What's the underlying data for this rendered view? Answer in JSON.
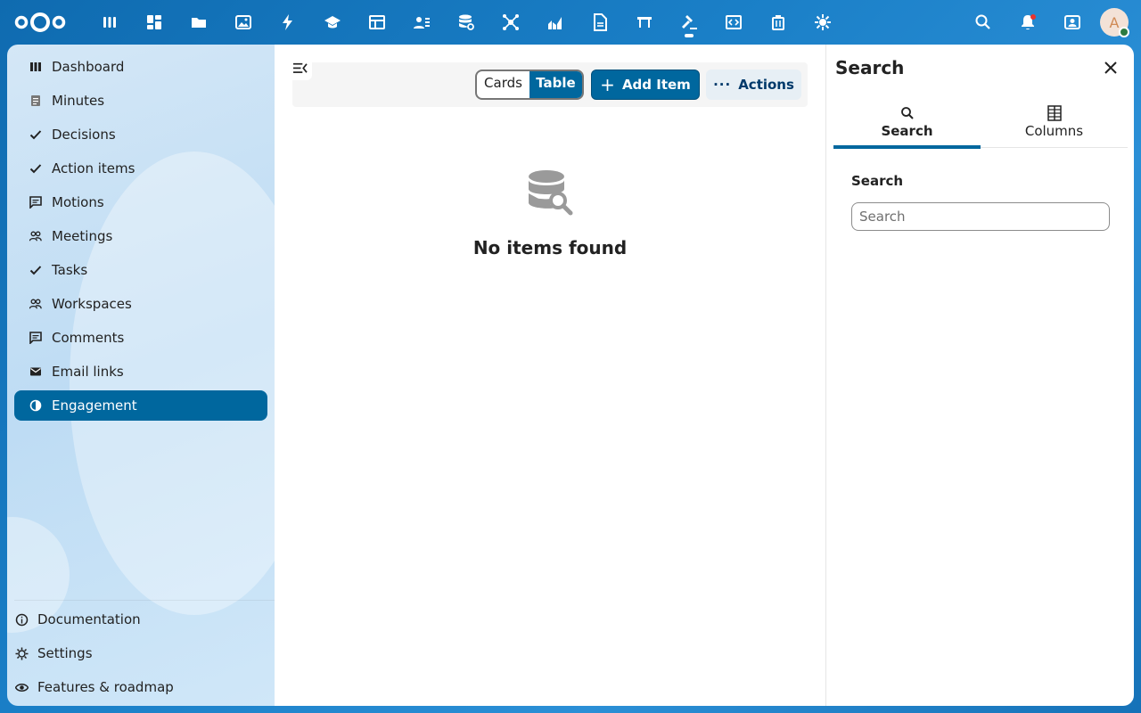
{
  "header": {
    "app_icons": [
      "deck-icon",
      "dashboard-icon",
      "files-icon",
      "photos-icon",
      "activity-icon",
      "learning-icon",
      "tables-icon",
      "contacts-icon",
      "database-icon",
      "flow-icon",
      "analytics-icon",
      "document-icon",
      "whiteboard-icon",
      "gavel-icon",
      "code-icon",
      "trash-icon",
      "settings-gear-icon"
    ],
    "active_app_index": 13,
    "avatar_letter": "A"
  },
  "nav": {
    "items": [
      {
        "label": "Dashboard",
        "icon": "dashboard-icon"
      },
      {
        "label": "Minutes",
        "icon": "document-icon"
      },
      {
        "label": "Decisions",
        "icon": "check-icon"
      },
      {
        "label": "Action items",
        "icon": "check-icon"
      },
      {
        "label": "Motions",
        "icon": "comment-icon"
      },
      {
        "label": "Meetings",
        "icon": "people-icon"
      },
      {
        "label": "Tasks",
        "icon": "check-icon"
      },
      {
        "label": "Workspaces",
        "icon": "people-icon"
      },
      {
        "label": "Comments",
        "icon": "comment-icon"
      },
      {
        "label": "Email links",
        "icon": "email-icon"
      },
      {
        "label": "Engagement",
        "icon": "pie-chart-icon",
        "active": true
      }
    ],
    "footer": [
      {
        "label": "Documentation",
        "icon": "info-icon"
      },
      {
        "label": "Settings",
        "icon": "gear-icon"
      },
      {
        "label": "Features & roadmap",
        "icon": "eye-icon"
      }
    ]
  },
  "main": {
    "view_cards": "Cards",
    "view_table": "Table",
    "add_item": "Add Item",
    "actions": "Actions",
    "empty_title": "No items found"
  },
  "right_panel": {
    "title": "Search",
    "tab_search": "Search",
    "tab_columns": "Columns",
    "search_label": "Search",
    "search_placeholder": "Search",
    "search_value": ""
  },
  "colors": {
    "primary": "#00679e",
    "header_bg": "#1672b8"
  }
}
